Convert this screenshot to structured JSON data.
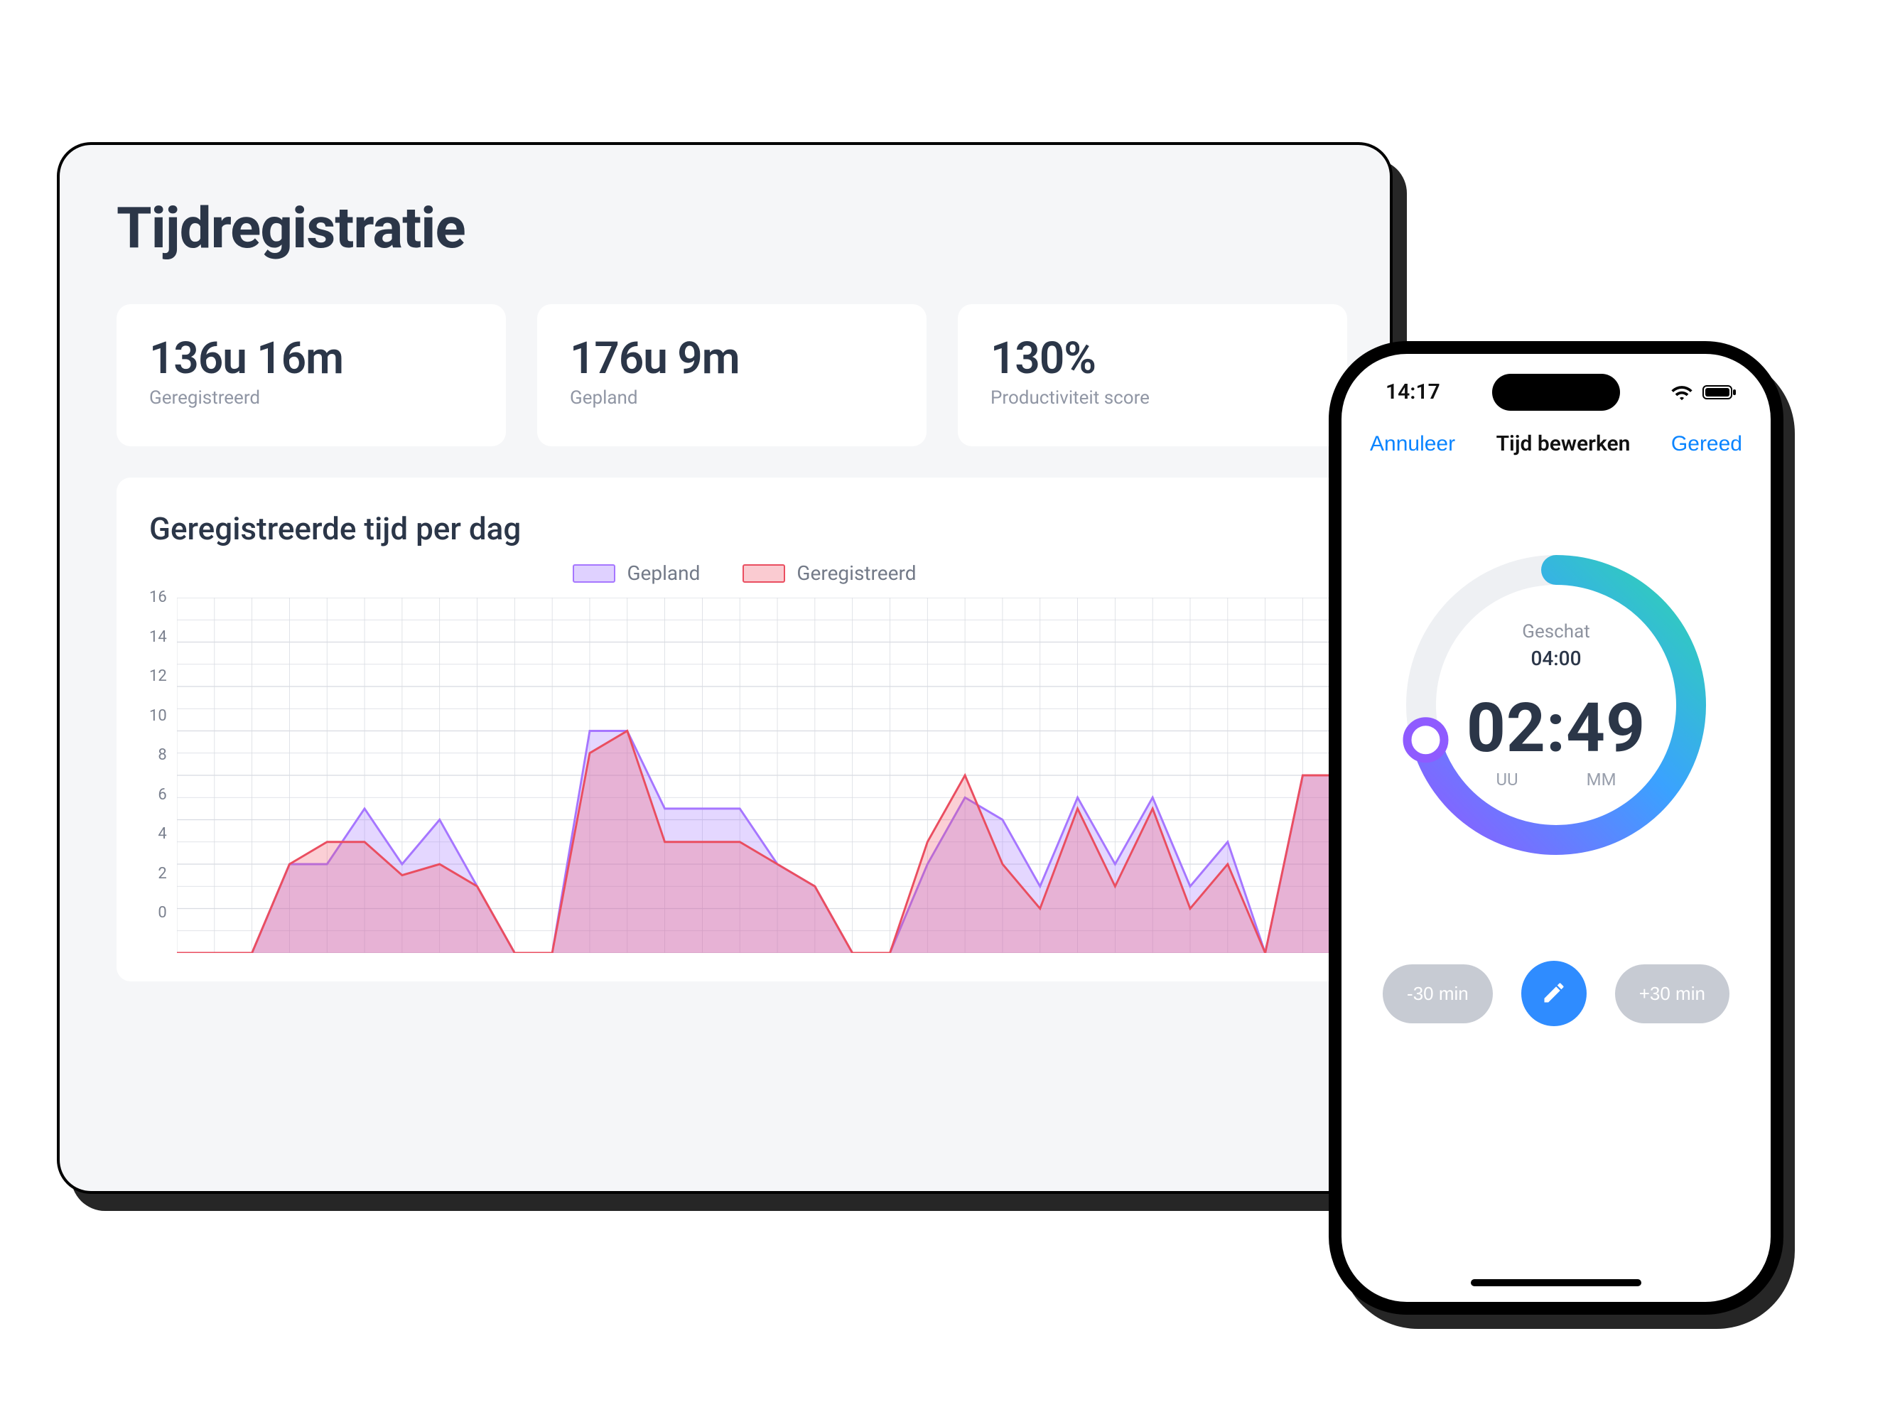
{
  "dashboard": {
    "title": "Tijdregistratie",
    "stats": {
      "registered": {
        "value": "136u 16m",
        "label": "Geregistreerd"
      },
      "planned": {
        "value": "176u 9m",
        "label": "Gepland"
      },
      "score": {
        "value": "130%",
        "label": "Productiviteit score"
      }
    },
    "chart": {
      "title": "Geregistreerde tijd per dag",
      "legend": {
        "planned": "Gepland",
        "registered": "Geregistreerd"
      },
      "y_ticks": [
        "0",
        "2",
        "4",
        "6",
        "8",
        "10",
        "12",
        "14",
        "16"
      ]
    }
  },
  "phone": {
    "status_time": "14:17",
    "nav": {
      "cancel": "Annuleer",
      "title": "Tijd bewerken",
      "done": "Gereed"
    },
    "timer": {
      "est_label": "Geschat",
      "est_value": "04:00",
      "time": "02:49",
      "hh_label": "UU",
      "mm_label": "MM"
    },
    "buttons": {
      "minus": "-30 min",
      "plus": "+30 min"
    }
  },
  "chart_data": {
    "type": "area",
    "xlabel": "",
    "ylabel": "",
    "ylim": [
      0,
      16
    ],
    "x": [
      0,
      1,
      2,
      3,
      4,
      5,
      6,
      7,
      8,
      9,
      10,
      11,
      12,
      13,
      14,
      15,
      16,
      17,
      18,
      19,
      20,
      21,
      22,
      23,
      24,
      25,
      26,
      27,
      28,
      29,
      30,
      31
    ],
    "series": [
      {
        "name": "Gepland",
        "color": "#a676ff",
        "values": [
          0,
          0,
          0,
          4,
          4,
          6.5,
          4,
          6,
          3,
          0,
          0,
          10,
          10,
          6.5,
          6.5,
          6.5,
          4,
          3,
          0,
          0,
          4,
          7,
          6,
          3,
          7,
          4,
          7,
          3,
          5,
          0,
          8,
          8
        ]
      },
      {
        "name": "Geregistreerd",
        "color": "#ea4e60",
        "values": [
          0,
          0,
          0,
          4,
          5,
          5,
          3.5,
          4,
          3,
          0,
          0,
          9,
          10,
          5,
          5,
          5,
          4,
          3,
          0,
          0,
          5,
          8,
          4,
          2,
          6.5,
          3,
          6.5,
          2,
          4,
          0,
          8,
          8
        ]
      }
    ]
  }
}
